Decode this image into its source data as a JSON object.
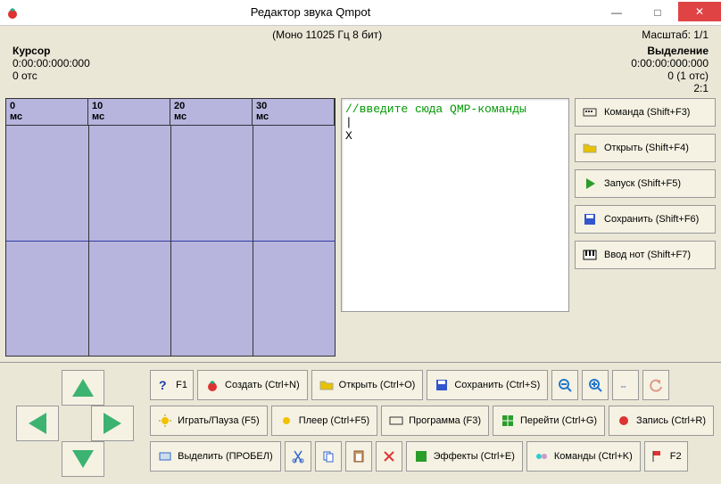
{
  "window": {
    "title": "Редактор звука Qmpot",
    "min": "—",
    "max": "□",
    "close": "✕"
  },
  "audio_info": "(Моно 11025 Гц 8 бит)",
  "scale_label": "Масштаб: 1/1",
  "cursor": {
    "label": "Курсор",
    "time": "0:00:00:000:000",
    "samples": "0 отс"
  },
  "selection": {
    "label": "Выделение",
    "time": "0:00:00:000:000",
    "samples": "0 (1 отс)",
    "ratio": "2:1"
  },
  "ruler": [
    {
      "n": "0",
      "u": "мс"
    },
    {
      "n": "10",
      "u": "мс"
    },
    {
      "n": "20",
      "u": "мс"
    },
    {
      "n": "30",
      "u": "мс"
    }
  ],
  "editor": {
    "comment": "//введите сюда QMP-команды",
    "body": "|\nX"
  },
  "side": [
    {
      "label": "Команда (Shift+F3)",
      "icon": "keyboard"
    },
    {
      "label": "Открыть (Shift+F4)",
      "icon": "folder"
    },
    {
      "label": "Запуск (Shift+F5)",
      "icon": "play"
    },
    {
      "label": "Сохранить (Shift+F6)",
      "icon": "save"
    },
    {
      "label": "Ввод нот (Shift+F7)",
      "icon": "piano"
    }
  ],
  "rows": {
    "r1": [
      {
        "label": "F1",
        "icon": "help"
      },
      {
        "label": "Создать (Ctrl+N)",
        "icon": "tomato"
      },
      {
        "label": "Открыть (Ctrl+O)",
        "icon": "folder"
      },
      {
        "label": "Сохранить (Ctrl+S)",
        "icon": "save"
      },
      {
        "label": "",
        "icon": "zoom-out"
      },
      {
        "label": "",
        "icon": "zoom-in"
      },
      {
        "label": "",
        "icon": "zoom-fit"
      },
      {
        "label": "",
        "icon": "undo"
      }
    ],
    "r2": [
      {
        "label": "Играть/Пауза (F5)",
        "icon": "sun"
      },
      {
        "label": "Плеер (Ctrl+F5)",
        "icon": "sun"
      },
      {
        "label": "Программа (F3)",
        "icon": "keyboard"
      },
      {
        "label": "Перейти (Ctrl+G)",
        "icon": "grid"
      },
      {
        "label": "Запись (Ctrl+R)",
        "icon": "record"
      }
    ],
    "r3": [
      {
        "label": "Выделить (ПРОБЕЛ)",
        "icon": "select"
      },
      {
        "label": "",
        "icon": "cut"
      },
      {
        "label": "",
        "icon": "copy"
      },
      {
        "label": "",
        "icon": "paste"
      },
      {
        "label": "",
        "icon": "delete"
      },
      {
        "label": "Эффекты (Ctrl+E)",
        "icon": "fx"
      },
      {
        "label": "Команды (Ctrl+K)",
        "icon": "cmd"
      },
      {
        "label": "F2",
        "icon": "flag"
      }
    ]
  }
}
